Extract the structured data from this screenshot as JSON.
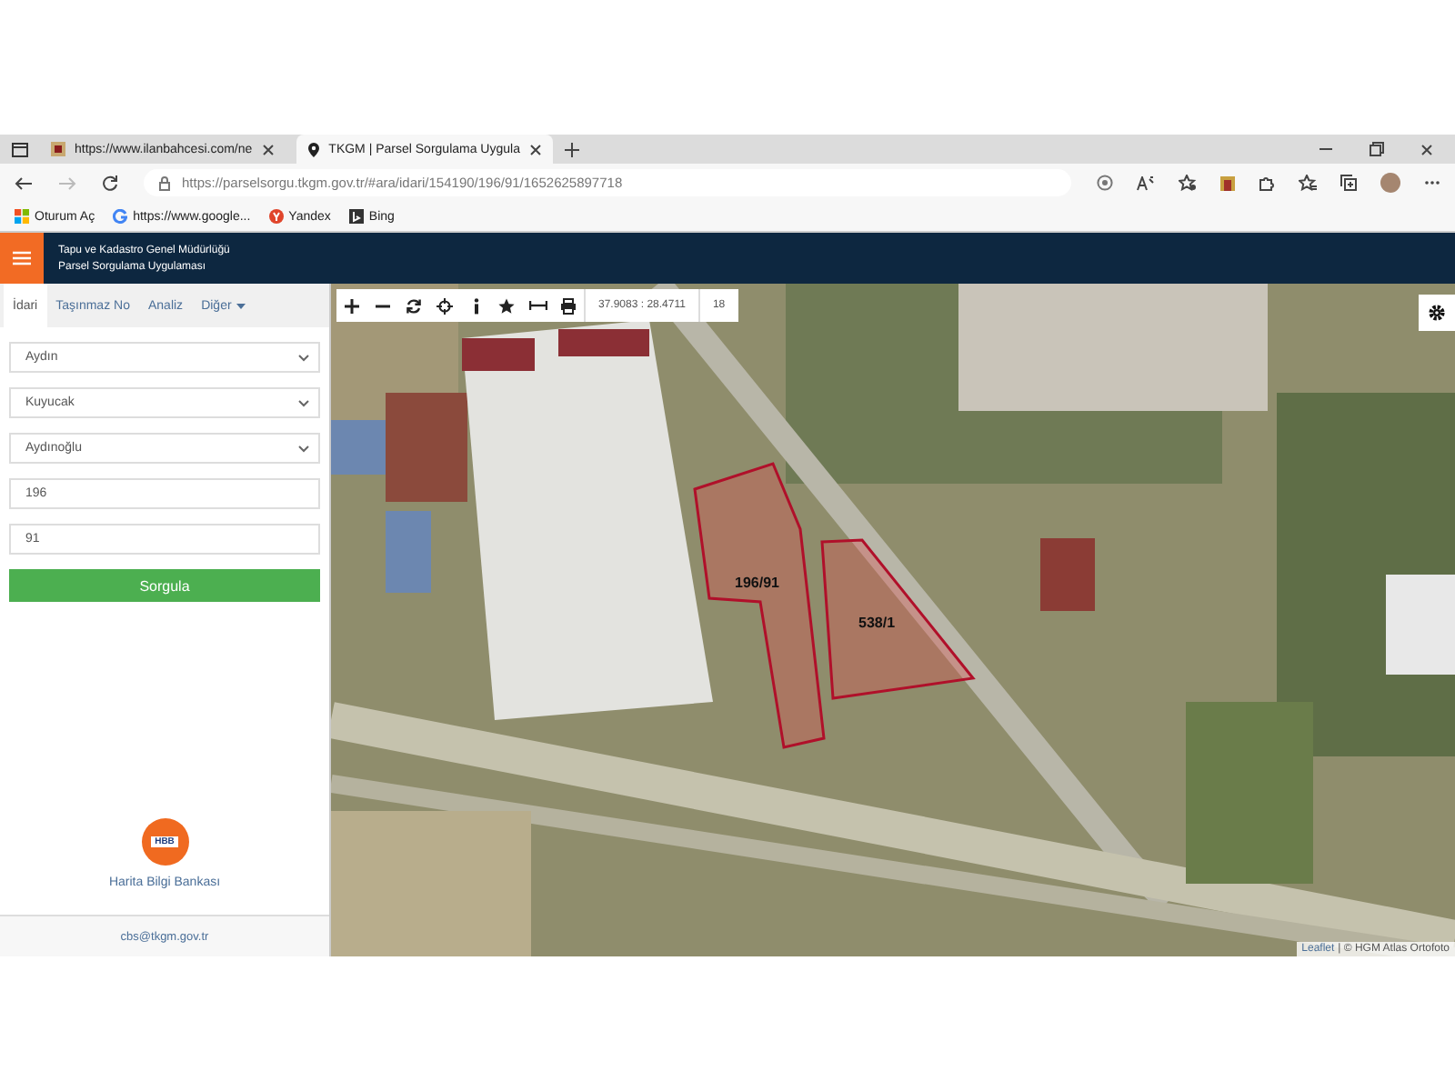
{
  "browser": {
    "tabs": [
      {
        "title": "https://www.ilanbahcesi.com/ne",
        "selected": false
      },
      {
        "title": "TKGM | Parsel Sorgulama Uygula",
        "selected": true
      }
    ],
    "url": "https://parselsorgu.tkgm.gov.tr/#ara/idari/154190/196/91/1652625897718",
    "bookmarks": [
      "Oturum Aç",
      "https://www.google...",
      "Yandex",
      "Bing"
    ]
  },
  "header": {
    "line_1": "Tapu ve Kadastro Genel Müdürlüğü",
    "line_2": "Parsel Sorgulama Uygulaması"
  },
  "sidebar": {
    "tabs": [
      {
        "label": "İdari",
        "selected": true,
        "kind": "plain"
      },
      {
        "label": "Taşınmaz No",
        "selected": false,
        "kind": "plain"
      },
      {
        "label": "Analiz",
        "selected": false,
        "kind": "plain"
      },
      {
        "label": "Diğer",
        "selected": false,
        "kind": "dropdown"
      }
    ],
    "selects": [
      "Aydın",
      "Kuyucak",
      "Aydınoğlu"
    ],
    "inputs": [
      "196",
      "91"
    ],
    "button": "Sorgula",
    "logo_text": "HBB",
    "logo_caption": "Harita Bilgi Bankası",
    "footer": "cbs@tkgm.gov.tr"
  },
  "map": {
    "coordinates": "37.9083 : 28.4711",
    "zoom": "18",
    "parcels": [
      {
        "label": "196/91"
      },
      {
        "label": "538/1"
      }
    ],
    "attribution_link": "Leaflet",
    "attribution": "| © HGM Atlas Ortofoto"
  }
}
